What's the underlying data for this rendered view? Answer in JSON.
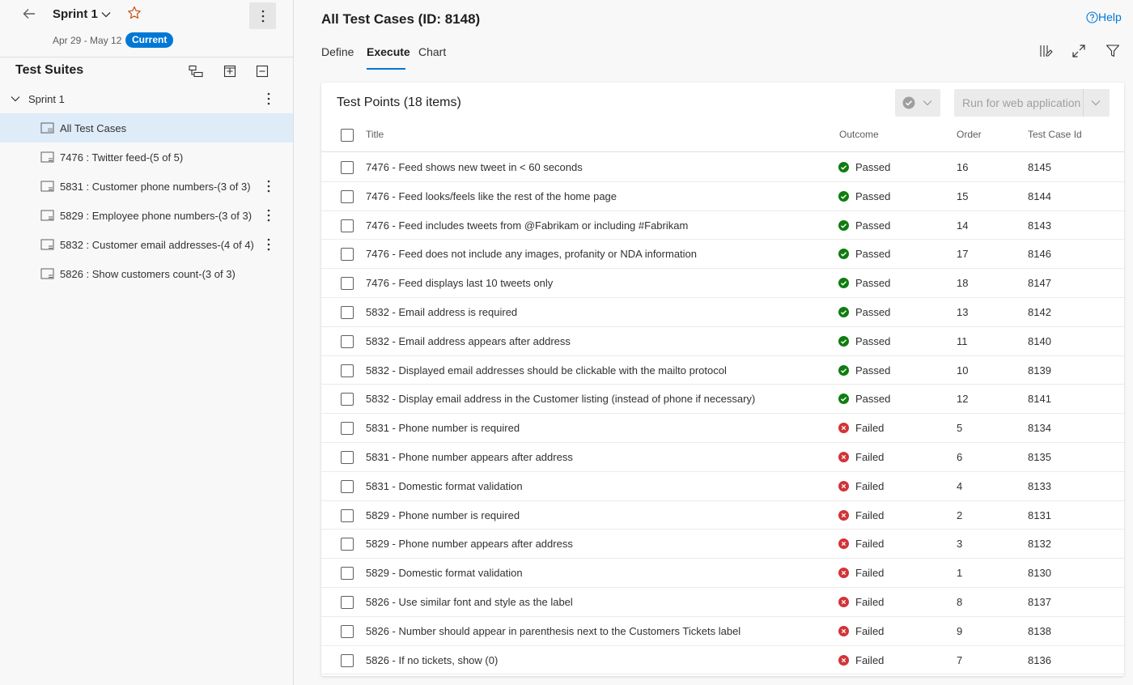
{
  "sidebar": {
    "sprint_title": "Sprint 1",
    "dates": "Apr 29 - May 12",
    "badge": "Current",
    "suites_title": "Test Suites",
    "tree_root": "Sprint 1",
    "items": [
      {
        "label": "All Test Cases",
        "selected": true
      },
      {
        "label": "7476 : Twitter feed-(5 of 5)"
      },
      {
        "label": "5831 : Customer phone numbers-(3 of 3)"
      },
      {
        "label": "5829 : Employee phone numbers-(3 of 3)"
      },
      {
        "label": "5832 : Customer email addresses-(4 of 4)"
      },
      {
        "label": "5826 : Show customers count-(3 of 3)"
      }
    ]
  },
  "header": {
    "title": "All Test Cases (ID: 8148)",
    "help": "Help",
    "tabs": [
      {
        "label": "Define"
      },
      {
        "label": "Execute"
      },
      {
        "label": "Chart"
      }
    ]
  },
  "grid": {
    "title": "Test Points (18 items)",
    "run_button": "Run for web application",
    "columns": {
      "title": "Title",
      "outcome": "Outcome",
      "order": "Order",
      "id": "Test Case Id"
    },
    "rows": [
      {
        "title": "7476 - Feed shows new tweet in < 60 seconds",
        "outcome": "Passed",
        "order": "16",
        "id": "8145"
      },
      {
        "title": "7476 - Feed looks/feels like the rest of the home page",
        "outcome": "Passed",
        "order": "15",
        "id": "8144"
      },
      {
        "title": "7476 - Feed includes tweets from @Fabrikam or including #Fabrikam",
        "outcome": "Passed",
        "order": "14",
        "id": "8143"
      },
      {
        "title": "7476 - Feed does not include any images, profanity or NDA information",
        "outcome": "Passed",
        "order": "17",
        "id": "8146"
      },
      {
        "title": "7476 - Feed displays last 10 tweets only",
        "outcome": "Passed",
        "order": "18",
        "id": "8147"
      },
      {
        "title": "5832 - Email address is required",
        "outcome": "Passed",
        "order": "13",
        "id": "8142"
      },
      {
        "title": "5832 - Email address appears after address",
        "outcome": "Passed",
        "order": "11",
        "id": "8140"
      },
      {
        "title": "5832 - Displayed email addresses should be clickable with the mailto protocol",
        "outcome": "Passed",
        "order": "10",
        "id": "8139"
      },
      {
        "title": "5832 - Display email address in the Customer listing (instead of phone if necessary)",
        "outcome": "Passed",
        "order": "12",
        "id": "8141"
      },
      {
        "title": "5831 - Phone number is required",
        "outcome": "Failed",
        "order": "5",
        "id": "8134"
      },
      {
        "title": "5831 - Phone number appears after address",
        "outcome": "Failed",
        "order": "6",
        "id": "8135"
      },
      {
        "title": "5831 - Domestic format validation",
        "outcome": "Failed",
        "order": "4",
        "id": "8133"
      },
      {
        "title": "5829 - Phone number is required",
        "outcome": "Failed",
        "order": "2",
        "id": "8131"
      },
      {
        "title": "5829 - Phone number appears after address",
        "outcome": "Failed",
        "order": "3",
        "id": "8132"
      },
      {
        "title": "5829 - Domestic format validation",
        "outcome": "Failed",
        "order": "1",
        "id": "8130"
      },
      {
        "title": "5826 - Use similar font and style as the label",
        "outcome": "Failed",
        "order": "8",
        "id": "8137"
      },
      {
        "title": "5826 - Number should appear in parenthesis next to the Customers Tickets label",
        "outcome": "Failed",
        "order": "9",
        "id": "8138"
      },
      {
        "title": "5826 - If no tickets, show (0)",
        "outcome": "Failed",
        "order": "7",
        "id": "8136"
      }
    ]
  },
  "colors": {
    "accent": "#0078d4",
    "passed": "#107c10",
    "failed": "#d13438",
    "selected_bg": "#deecf9"
  }
}
